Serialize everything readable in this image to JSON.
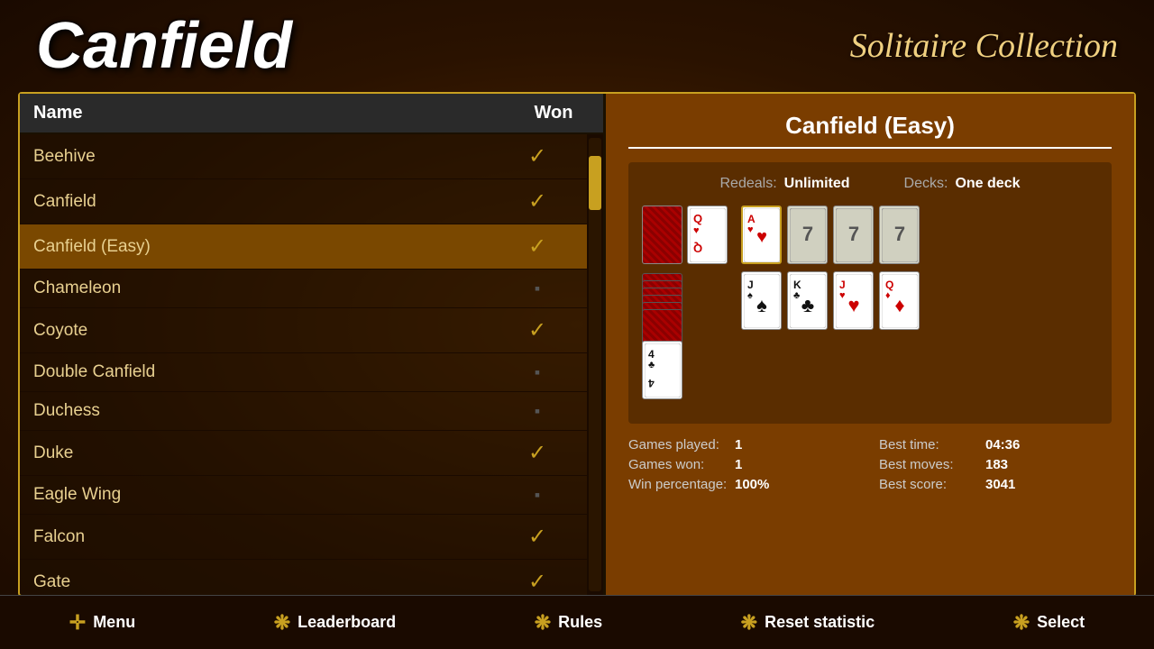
{
  "header": {
    "title": "Canfield",
    "subtitle": "Solitaire Collection"
  },
  "list": {
    "columns": {
      "name": "Name",
      "won": "Won"
    },
    "items": [
      {
        "name": "Beehive",
        "won": true,
        "selected": false
      },
      {
        "name": "Canfield",
        "won": true,
        "selected": false
      },
      {
        "name": "Canfield (Easy)",
        "won": true,
        "selected": true
      },
      {
        "name": "Chameleon",
        "won": false,
        "selected": false
      },
      {
        "name": "Coyote",
        "won": true,
        "selected": false
      },
      {
        "name": "Double Canfield",
        "won": false,
        "selected": false
      },
      {
        "name": "Duchess",
        "won": false,
        "selected": false
      },
      {
        "name": "Duke",
        "won": true,
        "selected": false
      },
      {
        "name": "Eagle Wing",
        "won": false,
        "selected": false
      },
      {
        "name": "Falcon",
        "won": true,
        "selected": false
      },
      {
        "name": "Gate",
        "won": true,
        "selected": false
      }
    ]
  },
  "detail": {
    "title": "Canfield (Easy)",
    "redeals_label": "Redeals:",
    "redeals_value": "Unlimited",
    "decks_label": "Decks:",
    "decks_value": "One deck",
    "stats": {
      "games_played_label": "Games played:",
      "games_played_value": "1",
      "games_won_label": "Games won:",
      "games_won_value": "1",
      "win_pct_label": "Win percentage:",
      "win_pct_value": "100%",
      "best_time_label": "Best time:",
      "best_time_value": "04:36",
      "best_moves_label": "Best moves:",
      "best_moves_value": "183",
      "best_score_label": "Best score:",
      "best_score_value": "3041"
    }
  },
  "nav": {
    "menu_label": "Menu",
    "leaderboard_label": "Leaderboard",
    "rules_label": "Rules",
    "reset_label": "Reset statistic",
    "select_label": "Select"
  }
}
